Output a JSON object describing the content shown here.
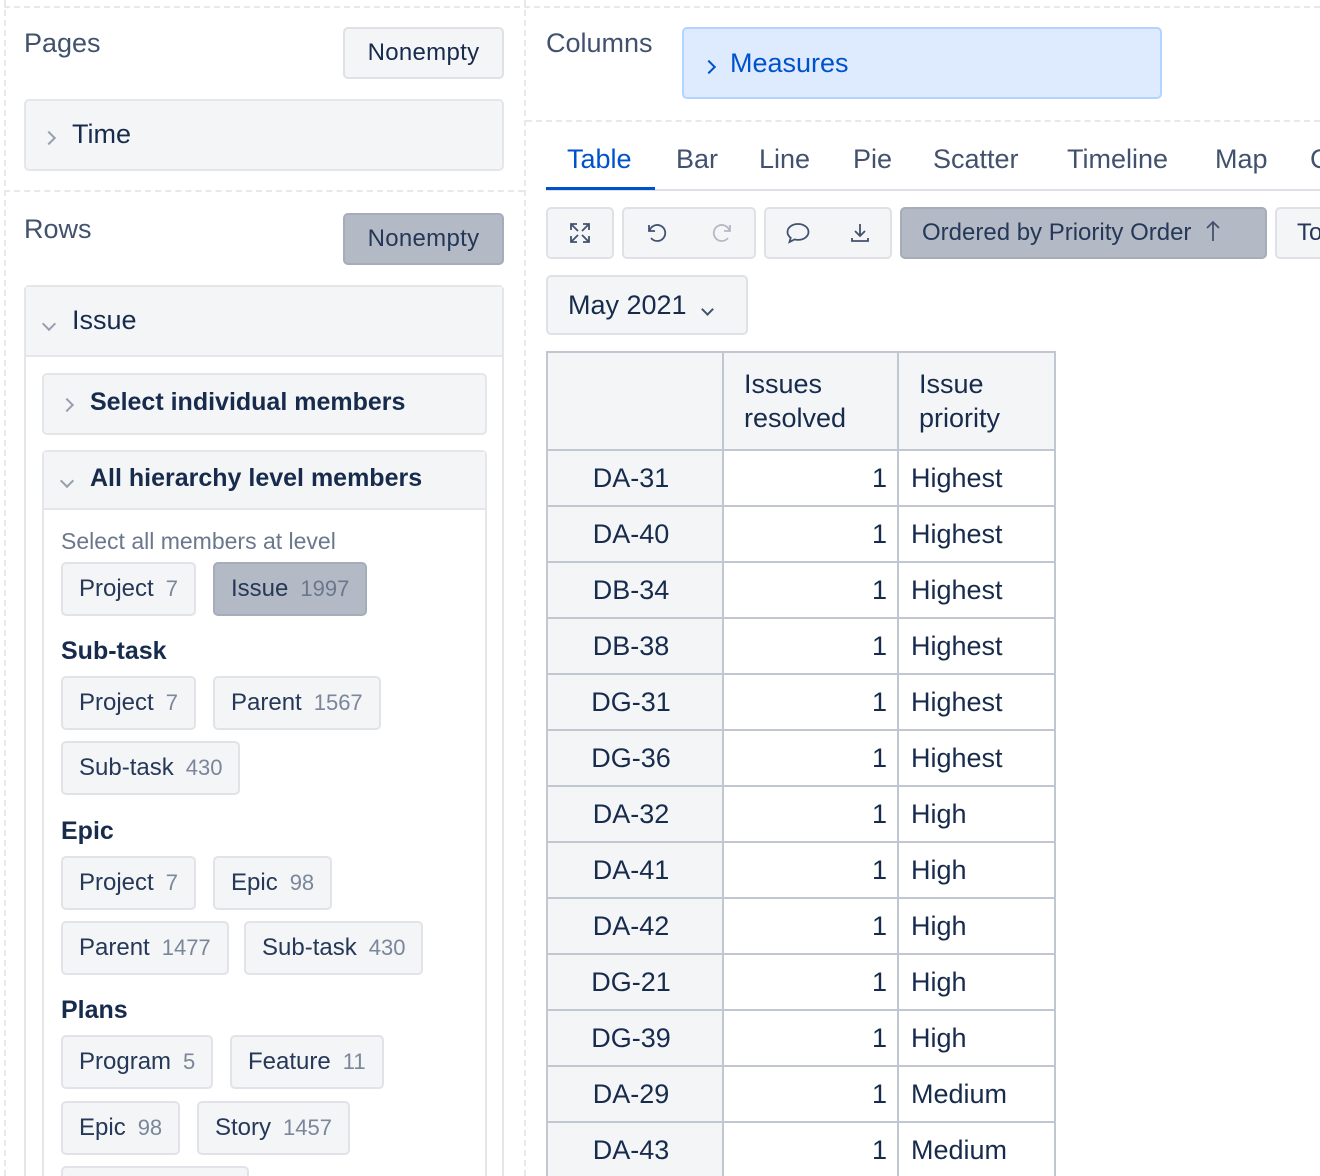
{
  "left": {
    "pages": {
      "label": "Pages",
      "nonempty_label": "Nonempty",
      "time_label": "Time"
    },
    "rows": {
      "label": "Rows",
      "nonempty_label": "Nonempty",
      "issue_label": "Issue",
      "select_individual_label": "Select individual members",
      "all_hierarchy_label": "All hierarchy level members",
      "select_all_hint": "Select all members at level",
      "default_levels": [
        {
          "name": "Project",
          "count": "7"
        },
        {
          "name": "Issue",
          "count": "1997"
        }
      ],
      "subtask_group": {
        "title": "Sub-task",
        "levels": [
          {
            "name": "Project",
            "count": "7"
          },
          {
            "name": "Parent",
            "count": "1567"
          },
          {
            "name": "Sub-task",
            "count": "430"
          }
        ]
      },
      "epic_group": {
        "title": "Epic",
        "levels": [
          {
            "name": "Project",
            "count": "7"
          },
          {
            "name": "Epic",
            "count": "98"
          },
          {
            "name": "Parent",
            "count": "1477"
          },
          {
            "name": "Sub-task",
            "count": "430"
          }
        ]
      },
      "plans_group": {
        "title": "Plans",
        "levels": [
          {
            "name": "Program",
            "count": "5"
          },
          {
            "name": "Feature",
            "count": "11"
          },
          {
            "name": "Epic",
            "count": "98"
          },
          {
            "name": "Story",
            "count": "1457"
          }
        ]
      }
    }
  },
  "columns": {
    "label": "Columns",
    "measures_label": "Measures"
  },
  "tabs": [
    "Table",
    "Bar",
    "Line",
    "Pie",
    "Scatter",
    "Timeline",
    "Map",
    "C"
  ],
  "active_tab": "Table",
  "toolbar": {
    "order_label": "Ordered by Priority Order",
    "to_label": "To"
  },
  "page_filter": "May 2021",
  "table": {
    "headers": [
      "",
      "Issues resolved",
      "Issue priority"
    ],
    "header_lines": [
      [
        "Issues",
        "resolved"
      ],
      [
        "Issue",
        "priority"
      ]
    ],
    "rows": [
      {
        "key": "DA-31",
        "resolved": "1",
        "priority": "Highest"
      },
      {
        "key": "DA-40",
        "resolved": "1",
        "priority": "Highest"
      },
      {
        "key": "DB-34",
        "resolved": "1",
        "priority": "Highest"
      },
      {
        "key": "DB-38",
        "resolved": "1",
        "priority": "Highest"
      },
      {
        "key": "DG-31",
        "resolved": "1",
        "priority": "Highest"
      },
      {
        "key": "DG-36",
        "resolved": "1",
        "priority": "Highest"
      },
      {
        "key": "DA-32",
        "resolved": "1",
        "priority": "High"
      },
      {
        "key": "DA-41",
        "resolved": "1",
        "priority": "High"
      },
      {
        "key": "DA-42",
        "resolved": "1",
        "priority": "High"
      },
      {
        "key": "DG-21",
        "resolved": "1",
        "priority": "High"
      },
      {
        "key": "DG-39",
        "resolved": "1",
        "priority": "High"
      },
      {
        "key": "DA-29",
        "resolved": "1",
        "priority": "Medium"
      },
      {
        "key": "DA-43",
        "resolved": "1",
        "priority": "Medium"
      }
    ]
  },
  "colors": {
    "accent": "#0052cc",
    "selected_bg": "#b3bac5",
    "measures_bg": "#deebff"
  }
}
